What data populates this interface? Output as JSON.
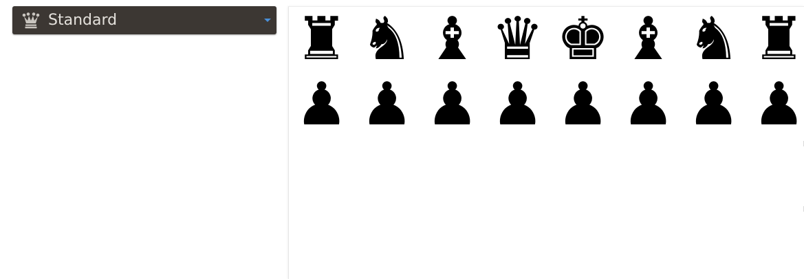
{
  "variant_select": {
    "label": "Standard",
    "icon": "crown-icon",
    "caret_icon": "caret-down-icon",
    "background": "#3c3733",
    "text_color": "#e4e1dc",
    "caret_color": "#4a90d9"
  },
  "board": {
    "back_rank": [
      {
        "name": "rook",
        "glyph": "♜"
      },
      {
        "name": "knight",
        "glyph": "♞"
      },
      {
        "name": "bishop",
        "glyph": "♝"
      },
      {
        "name": "queen",
        "glyph": "♛"
      },
      {
        "name": "king",
        "glyph": "♚"
      },
      {
        "name": "bishop",
        "glyph": "♝"
      },
      {
        "name": "knight",
        "glyph": "♞"
      },
      {
        "name": "rook",
        "glyph": "♜"
      }
    ],
    "pawn_rank": [
      {
        "name": "pawn",
        "glyph": "♟"
      },
      {
        "name": "pawn",
        "glyph": "♟"
      },
      {
        "name": "pawn",
        "glyph": "♟"
      },
      {
        "name": "pawn",
        "glyph": "♟"
      },
      {
        "name": "pawn",
        "glyph": "♟"
      },
      {
        "name": "pawn",
        "glyph": "♟"
      },
      {
        "name": "pawn",
        "glyph": "♟"
      },
      {
        "name": "pawn",
        "glyph": "♟"
      }
    ],
    "piece_color": "black"
  }
}
